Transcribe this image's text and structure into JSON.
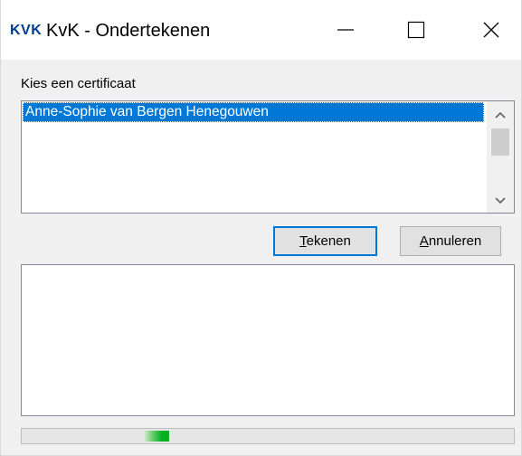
{
  "window": {
    "logo_text": "KVK",
    "title": "KvK - Ondertekenen"
  },
  "certificate": {
    "label": "Kies een certificaat",
    "items": [
      "Anne-Sophie van Bergen Henegouwen"
    ],
    "selected_index": 0
  },
  "buttons": {
    "sign": {
      "mnemonic": "T",
      "rest": "ekenen"
    },
    "cancel": {
      "mnemonic": "A",
      "rest": "nnuleren"
    }
  },
  "output": {
    "text": ""
  },
  "progress": {
    "mode": "indeterminate",
    "fill_start": 0.25,
    "fill_fraction": 0.05
  },
  "icons": {
    "minimize": "minimize-icon",
    "maximize": "maximize-icon",
    "close": "close-icon",
    "scroll_up": "chevron-up-icon",
    "scroll_down": "chevron-down-icon"
  },
  "colors": {
    "selection": "#0078d7",
    "brand": "#003c8f",
    "progress": "#06b025"
  }
}
